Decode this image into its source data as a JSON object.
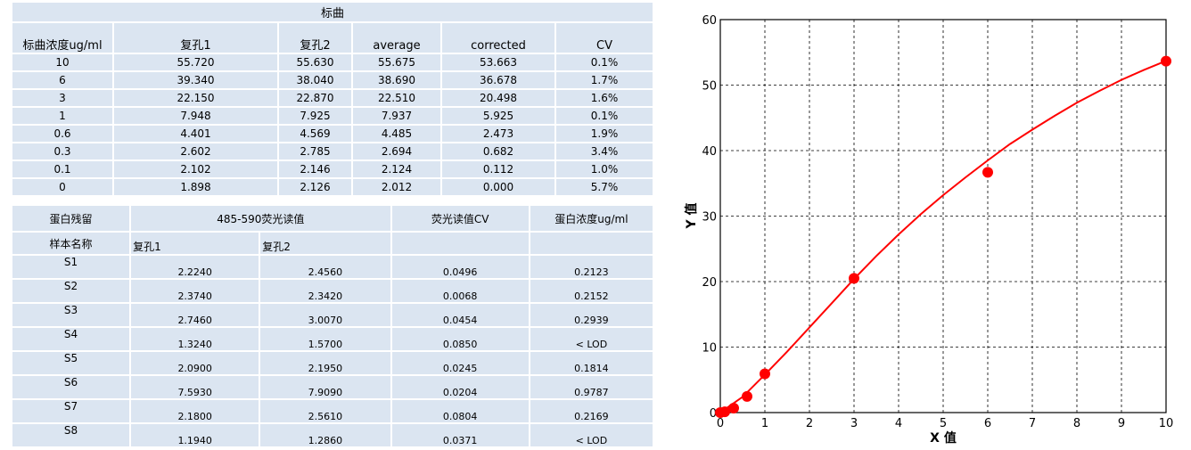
{
  "standard_table": {
    "title": "标曲",
    "headers": [
      "标曲浓度ug/ml",
      "复孔1",
      "复孔2",
      "average",
      "corrected",
      "CV"
    ],
    "rows": [
      [
        "10",
        "55.720",
        "55.630",
        "55.675",
        "53.663",
        "0.1%"
      ],
      [
        "6",
        "39.340",
        "38.040",
        "38.690",
        "36.678",
        "1.7%"
      ],
      [
        "3",
        "22.150",
        "22.870",
        "22.510",
        "20.498",
        "1.6%"
      ],
      [
        "1",
        "7.948",
        "7.925",
        "7.937",
        "5.925",
        "0.1%"
      ],
      [
        "0.6",
        "4.401",
        "4.569",
        "4.485",
        "2.473",
        "1.9%"
      ],
      [
        "0.3",
        "2.602",
        "2.785",
        "2.694",
        "0.682",
        "3.4%"
      ],
      [
        "0.1",
        "2.102",
        "2.146",
        "2.124",
        "0.112",
        "1.0%"
      ],
      [
        "0",
        "1.898",
        "2.126",
        "2.012",
        "0.000",
        "5.7%"
      ]
    ]
  },
  "sample_table": {
    "header1": [
      "蛋白残留",
      "485-590荧光读值",
      "荧光读值CV",
      "蛋白浓度ug/ml"
    ],
    "header2": [
      "样本名称",
      "复孔1",
      "复孔2"
    ],
    "rows": [
      [
        "S1",
        "2.2240",
        "2.4560",
        "0.0496",
        "0.2123"
      ],
      [
        "S2",
        "2.3740",
        "2.3420",
        "0.0068",
        "0.2152"
      ],
      [
        "S3",
        "2.7460",
        "3.0070",
        "0.0454",
        "0.2939"
      ],
      [
        "S4",
        "1.3240",
        "1.5700",
        "0.0850",
        "< LOD"
      ],
      [
        "S5",
        "2.0900",
        "2.1950",
        "0.0245",
        "0.1814"
      ],
      [
        "S6",
        "7.5930",
        "7.9090",
        "0.0204",
        "0.9787"
      ],
      [
        "S7",
        "2.1800",
        "2.5610",
        "0.0804",
        "0.2169"
      ],
      [
        "S8",
        "1.1940",
        "1.2860",
        "0.0371",
        "< LOD"
      ]
    ]
  },
  "chart_data": {
    "type": "scatter",
    "xlabel": "X 值",
    "ylabel": "Y 值",
    "xlim": [
      0,
      10
    ],
    "ylim": [
      0,
      60
    ],
    "xticks": [
      0,
      1,
      2,
      3,
      4,
      5,
      6,
      7,
      8,
      9,
      10
    ],
    "yticks": [
      0,
      10,
      20,
      30,
      40,
      50,
      60
    ],
    "grid": true,
    "points": {
      "x": [
        0,
        0.1,
        0.3,
        0.6,
        1,
        3,
        6,
        10
      ],
      "y": [
        0.0,
        0.112,
        0.682,
        2.473,
        5.925,
        20.498,
        36.678,
        53.663
      ]
    },
    "fit_curve": {
      "x": [
        0,
        0.5,
        1,
        1.5,
        2,
        2.5,
        3,
        3.5,
        4,
        4.5,
        5,
        5.5,
        6,
        6.5,
        7,
        7.5,
        8,
        8.5,
        9,
        9.5,
        10
      ],
      "y": [
        0,
        2.4,
        5.8,
        9.3,
        13.0,
        16.7,
        20.4,
        23.9,
        27.2,
        30.3,
        33.2,
        35.9,
        38.5,
        41.0,
        43.2,
        45.3,
        47.3,
        49.1,
        50.8,
        52.3,
        53.7
      ]
    },
    "colors": {
      "series": "#ff0000",
      "grid": "#000000"
    }
  }
}
